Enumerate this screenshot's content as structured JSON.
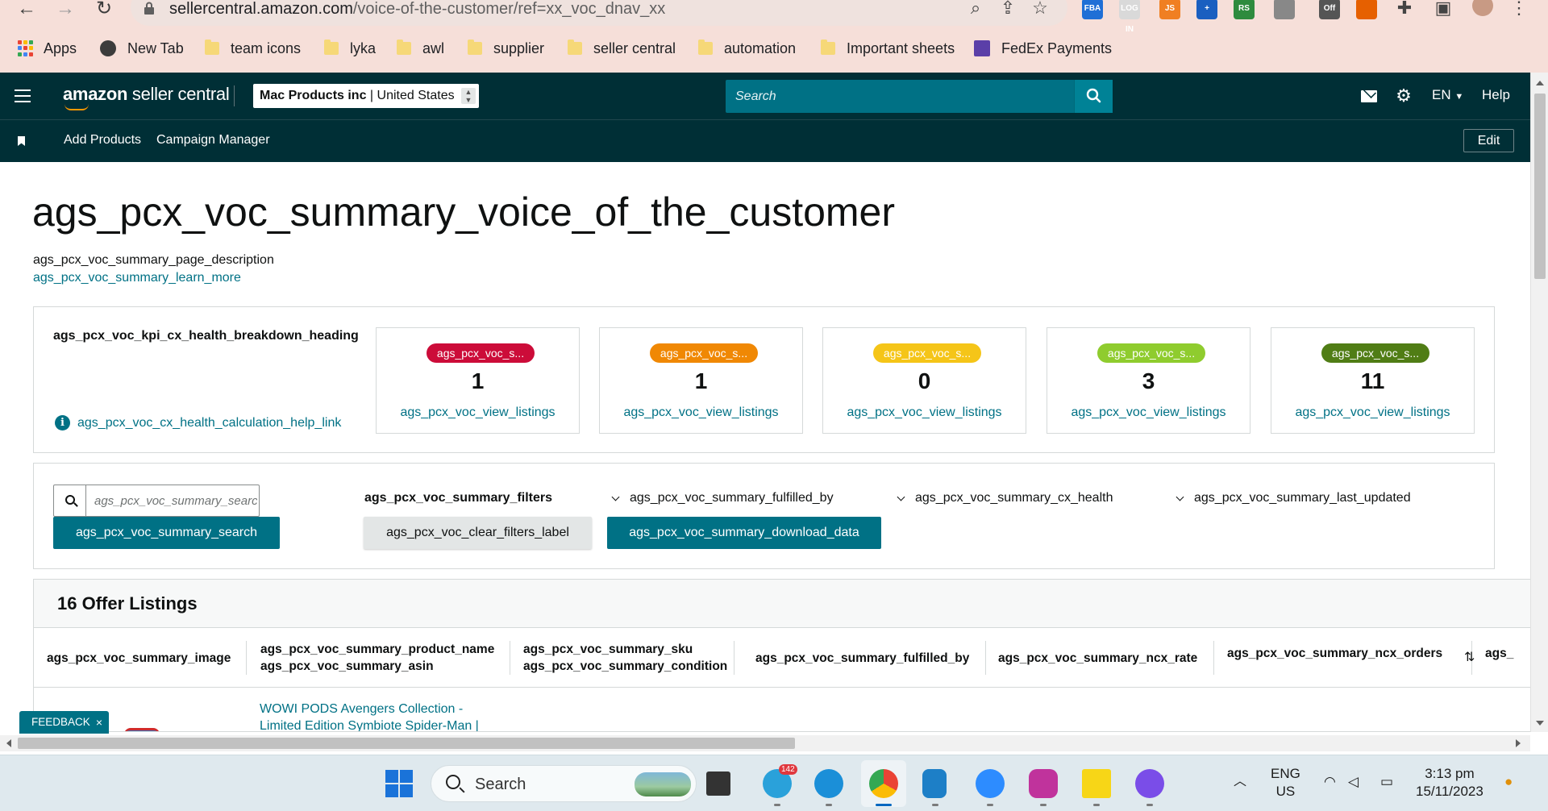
{
  "browser": {
    "url_host": "sellercentral.amazon.com",
    "url_path": "/voice-of-the-customer/ref=xx_voc_dnav_xx",
    "extensions": [
      {
        "name": "fba-extension-icon",
        "label": "FBA",
        "color": "#1f6fd6"
      },
      {
        "name": "login-extension-icon",
        "label": "LOG IN",
        "color": "#d9d9d9"
      },
      {
        "name": "js-extension-icon",
        "label": "JS",
        "color": "#f07f22"
      },
      {
        "name": "plus-extension-icon",
        "label": "+",
        "color": "#1a5fc0"
      },
      {
        "name": "rs-extension-icon",
        "label": "RS",
        "color": "#2e8b3e"
      },
      {
        "name": "headset-extension-icon",
        "label": "",
        "color": "#888888"
      },
      {
        "name": "off-extension-icon",
        "label": "Off",
        "color": "#555555"
      },
      {
        "name": "firefox-extension-icon",
        "label": "",
        "color": "#e66000"
      }
    ],
    "bookmarks": [
      {
        "label": "Apps",
        "icon": "apps-grid-icon"
      },
      {
        "label": "New Tab",
        "icon": "globe-icon"
      },
      {
        "label": "team icons",
        "icon": "folder-icon"
      },
      {
        "label": "lyka",
        "icon": "folder-icon"
      },
      {
        "label": "awl",
        "icon": "folder-icon"
      },
      {
        "label": "supplier",
        "icon": "folder-icon"
      },
      {
        "label": "seller central",
        "icon": "folder-icon"
      },
      {
        "label": "automation",
        "icon": "folder-icon"
      },
      {
        "label": "Important sheets",
        "icon": "folder-icon"
      },
      {
        "label": "FedEx Payments",
        "icon": "fedex-icon"
      }
    ]
  },
  "header": {
    "logo_bold": "amazon",
    "logo_rest": " seller central",
    "account_name": "Mac Products inc",
    "account_region": "United States",
    "search_placeholder": "Search",
    "language": "EN",
    "help": "Help"
  },
  "subnav": {
    "items": [
      "Add Products",
      "Campaign Manager"
    ],
    "edit": "Edit"
  },
  "page": {
    "title": "ags_pcx_voc_summary_voice_of_the_customer",
    "description": "ags_pcx_voc_summary_page_description",
    "learn_more": "ags_pcx_voc_summary_learn_more"
  },
  "kpi": {
    "heading": "ags_pcx_voc_kpi_cx_health_breakdown_heading",
    "help_link": "ags_pcx_voc_cx_health_calculation_help_link",
    "cards": [
      {
        "pill": "ags_pcx_voc_s...",
        "count": "1",
        "link": "ags_pcx_voc_view_listings",
        "color": "#cc0c39"
      },
      {
        "pill": "ags_pcx_voc_s...",
        "count": "1",
        "link": "ags_pcx_voc_view_listings",
        "color": "#f08804"
      },
      {
        "pill": "ags_pcx_voc_s...",
        "count": "0",
        "link": "ags_pcx_voc_view_listings",
        "color": "#f5c518"
      },
      {
        "pill": "ags_pcx_voc_s...",
        "count": "3",
        "link": "ags_pcx_voc_view_listings",
        "color": "#8fcc2e"
      },
      {
        "pill": "ags_pcx_voc_s...",
        "count": "11",
        "link": "ags_pcx_voc_view_listings",
        "color": "#507d15"
      }
    ]
  },
  "filters": {
    "search_placeholder": "ags_pcx_voc_summary_search",
    "search_button": "ags_pcx_voc_summary_search",
    "filters_label": "ags_pcx_voc_summary_filters",
    "clear_filters": "ags_pcx_voc_clear_filters_label",
    "download": "ags_pcx_voc_summary_download_data",
    "dropdowns": [
      "ags_pcx_voc_summary_fulfilled_by",
      "ags_pcx_voc_summary_cx_health",
      "ags_pcx_voc_summary_last_updated"
    ]
  },
  "table": {
    "title": "16 Offer Listings",
    "columns": [
      {
        "line1": "ags_pcx_voc_summary_image",
        "line2": ""
      },
      {
        "line1": "ags_pcx_voc_summary_product_name",
        "line2": "ags_pcx_voc_summary_asin"
      },
      {
        "line1": "ags_pcx_voc_summary_sku",
        "line2": "ags_pcx_voc_summary_condition"
      },
      {
        "line1": "ags_pcx_voc_summary_fulfilled_by",
        "line2": ""
      },
      {
        "line1": "ags_pcx_voc_summary_ncx_rate",
        "line2": ""
      },
      {
        "line1": "ags_pcx_voc_summary_ncx_orders",
        "line2": ""
      },
      {
        "line1": "ags_",
        "line2": ""
      }
    ],
    "sort_icon": "⇅",
    "rows": [
      {
        "product_line1": "WOWI PODS Avengers Collection -",
        "product_line2": "Limited Edition Symbiote Spider-Man |"
      }
    ]
  },
  "feedback": {
    "label": "FEEDBACK",
    "close": "×"
  },
  "taskbar": {
    "search_label": "Search",
    "telegram_badge": "142",
    "lang_line1": "ENG",
    "lang_line2": "US",
    "time": "3:13 pm",
    "date": "15/11/2023"
  }
}
